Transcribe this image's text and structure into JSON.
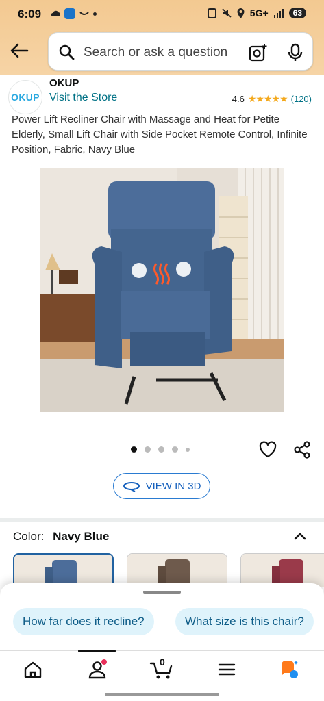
{
  "status_bar": {
    "time": "6:09",
    "network": "5G+",
    "battery": "63"
  },
  "search": {
    "placeholder": "Search or ask a question"
  },
  "brand": {
    "logo_text": "OKUP",
    "name": "OKUP",
    "visit_store": "Visit the Store",
    "rating": "4.6",
    "stars": "★★★★★",
    "rating_count": "(120)"
  },
  "product": {
    "title": "Power Lift Recliner Chair with Massage and Heat for Petite Elderly, Small Lift Chair with Side Pocket Remote Control, Infinite Position, Fabric, Navy Blue"
  },
  "view3d": {
    "label": "VIEW IN 3D"
  },
  "color": {
    "label": "Color:",
    "value": "Navy Blue"
  },
  "suggestions": [
    {
      "label": "How far does it recline?"
    },
    {
      "label": "What size is this chair?"
    }
  ],
  "cart": {
    "count": "0"
  },
  "colors": {
    "header_bg": "#f3c991",
    "link": "#007185",
    "accent_blue": "#2162a1",
    "chip_bg": "#dff3fb",
    "star": "#f4a91d"
  }
}
